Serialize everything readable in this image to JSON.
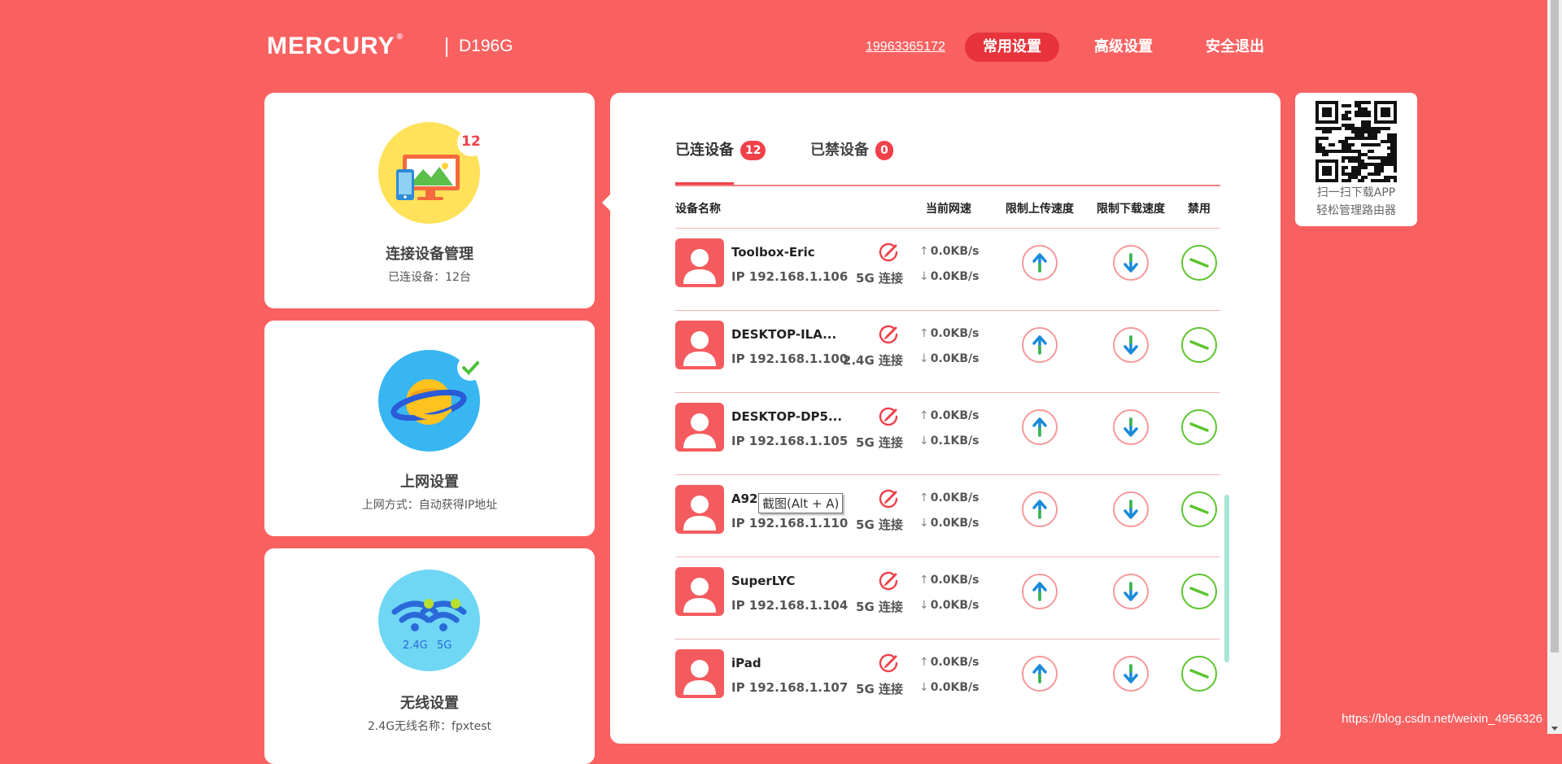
{
  "header": {
    "brand": "MERCURY",
    "model": "D196G",
    "phone": "19963365172",
    "nav": [
      "常用设置",
      "高级设置",
      "安全退出"
    ]
  },
  "left_cards": [
    {
      "title": "连接设备管理",
      "subtitle": "已连设备：12台",
      "badge": "12"
    },
    {
      "title": "上网设置",
      "subtitle": "上网方式：自动获得IP地址"
    },
    {
      "title": "无线设置",
      "subtitle": "2.4G无线名称：fpxtest",
      "band_24": "2.4G",
      "band_5": "5G"
    }
  ],
  "tabs": [
    {
      "label": "已连设备",
      "count": "12"
    },
    {
      "label": "已禁设备",
      "count": "0"
    }
  ],
  "table": {
    "headers": [
      "设备名称",
      "当前网速",
      "限制上传速度",
      "限制下载速度",
      "禁用"
    ],
    "rows": [
      {
        "name": "Toolbox-Eric",
        "ip": "IP 192.168.1.106",
        "conn": "5G 连接",
        "up": "0.0KB/s",
        "down": "0.0KB/s"
      },
      {
        "name": "DESKTOP-ILA...",
        "ip": "IP 192.168.1.100",
        "conn": "2.4G 连接",
        "up": "0.0KB/s",
        "down": "0.0KB/s"
      },
      {
        "name": "DESKTOP-DP5...",
        "ip": "IP 192.168.1.105",
        "conn": "5G 连接",
        "up": "0.0KB/s",
        "down": "0.1KB/s"
      },
      {
        "name": "A92",
        "ip": "IP 192.168.1.110",
        "conn": "5G 连接",
        "up": "0.0KB/s",
        "down": "0.0KB/s"
      },
      {
        "name": "SuperLYC",
        "ip": "IP 192.168.1.104",
        "conn": "5G 连接",
        "up": "0.0KB/s",
        "down": "0.0KB/s"
      },
      {
        "name": "iPad",
        "ip": "IP 192.168.1.107",
        "conn": "5G 连接",
        "up": "0.0KB/s",
        "down": "0.0KB/s"
      }
    ]
  },
  "tooltip": "截图(Alt + A)",
  "qr": {
    "line1": "扫一扫下载APP",
    "line2": "轻松管理路由器"
  },
  "watermark": "https://blog.csdn.net/weixin_4956326",
  "icons": {
    "edit": "edit-pencil-icon",
    "upload_limit": "arrow-up-icon",
    "download_limit": "arrow-down-icon",
    "ban": "ban-icon"
  },
  "colors": {
    "background": "#f96161",
    "accent": "#f0414a",
    "nav_active": "#e8333b",
    "ban_green": "#5cc42f",
    "arrow_blue": "#1a8ad8"
  }
}
